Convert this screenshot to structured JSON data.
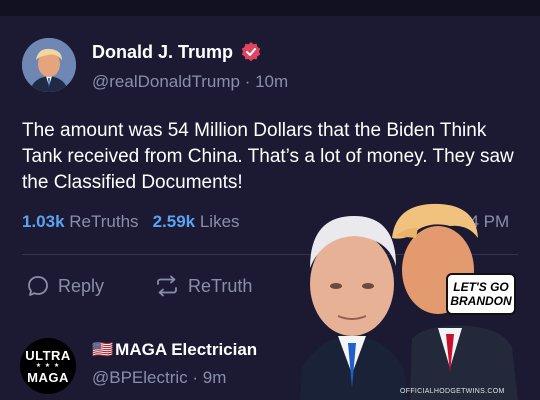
{
  "post": {
    "author_name": "Donald J. Trump",
    "handle": "@realDonaldTrump",
    "separator": " · ",
    "time_ago": "10m",
    "text": "The amount was 54 Million Dollars that the Biden Think Tank received from China. That’s a lot of money. They saw the Classified Documents!",
    "retruths_count": "1.03k",
    "retruths_label": "ReTruths",
    "likes_count": "2.59k",
    "likes_label": "Likes",
    "timestamp_fragment": "14 PM",
    "actions": {
      "reply_label": "Reply",
      "retruth_label": "ReTruth"
    }
  },
  "next_post": {
    "flag": "🇺🇸",
    "author_name": "MAGA Electrician",
    "handle": "@BPElectric",
    "separator": " · ",
    "time_ago": "9m",
    "avatar_line1": "ULTRA",
    "avatar_stars": "★ ★ ★",
    "avatar_line2": "MAGA"
  },
  "meme": {
    "sign_line1": "LET'S GO",
    "sign_line2": "BRANDON",
    "watermark": "OFFICIALHODGETWINS.COM"
  },
  "colors": {
    "background": "#1c1a33",
    "accent_blue": "#5aa3f0",
    "muted_text": "#8b8ea8",
    "verified_badge": "#e0455f"
  },
  "icons": [
    "verified-badge-icon",
    "reply-bubble-icon",
    "retruth-arrows-icon"
  ]
}
